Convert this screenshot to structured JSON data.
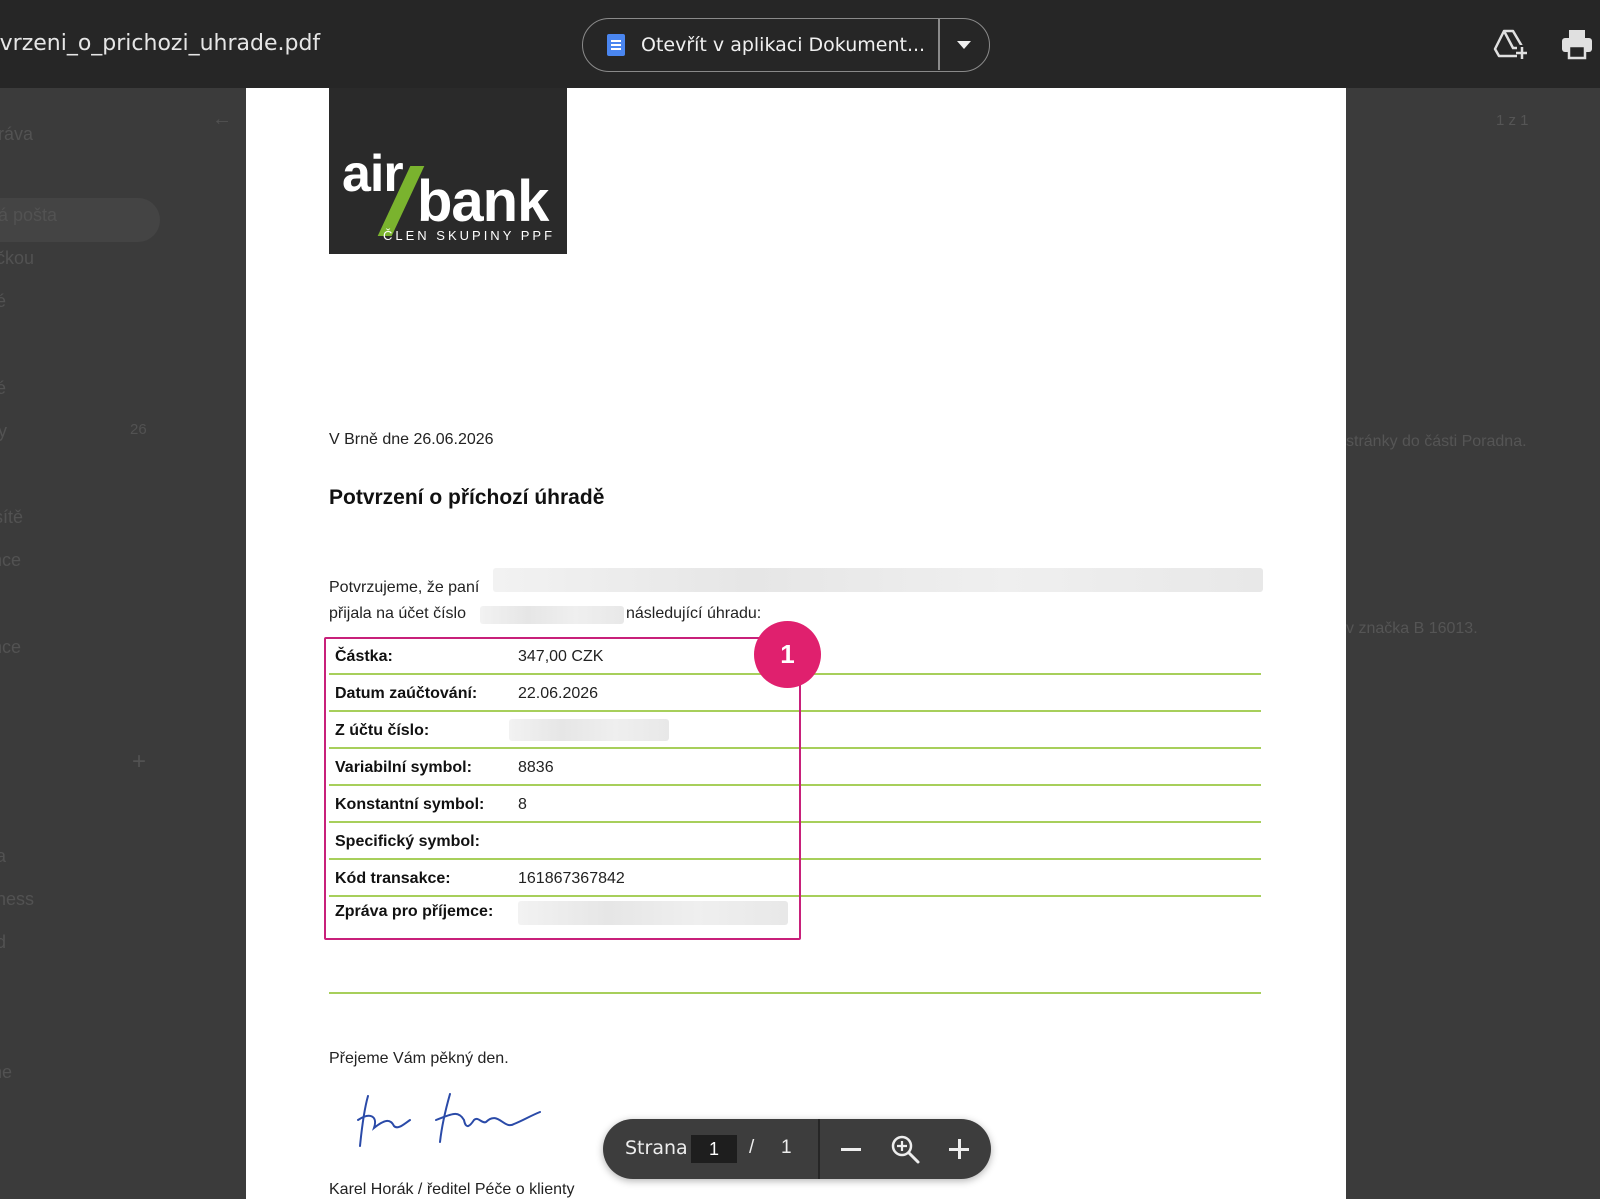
{
  "viewer": {
    "filename": "tvrzeni_o_prichozi_uhrade.pdf",
    "open_in_label": "Otevřít v aplikaci Dokument...",
    "icons": {
      "doc": "google-docs-icon",
      "dropdown": "chevron-down-icon",
      "drive": "add-to-drive-icon",
      "print": "print-icon"
    }
  },
  "background": {
    "left_items": [
      "ráva",
      "ná pošta",
      "čkou",
      "é",
      "é",
      "ry",
      "sítě",
      "nce",
      "nce",
      "a",
      "iness",
      "d",
      "ne"
    ],
    "left_count": "26",
    "right_texts": [
      "1 z 1",
      "stránky do části Poradna.",
      "v značka B 16013."
    ]
  },
  "document": {
    "logo": {
      "word1": "air",
      "word2": "bank",
      "subtitle": "ČLEN SKUPINY PPF",
      "brand_color": "#7ab32e"
    },
    "date_line": "V Brně dne  26.06.2026",
    "title": "Potvrzení o příchozí úhradě",
    "intro_line1": "Potvrzujeme, že paní",
    "intro_line2_a": "přijala na účet číslo",
    "intro_line2_b": "následující úhradu:",
    "rows": [
      {
        "label": "Částka:",
        "value": "347,00 CZK"
      },
      {
        "label": "Datum zaúčtování:",
        "value": "22.06.2026"
      },
      {
        "label": "Z účtu číslo:",
        "value": ""
      },
      {
        "label": "Variabilní symbol:",
        "value": "8836"
      },
      {
        "label": "Konstantní symbol:",
        "value": "8"
      },
      {
        "label": "Specifický symbol:",
        "value": ""
      },
      {
        "label": "Kód transakce:",
        "value": "161867367842"
      },
      {
        "label": "Zpráva pro příjemce:",
        "value": ""
      }
    ],
    "highlight_badge": "1",
    "highlight_color": "#e0206e",
    "closing": "Přejeme Vám pěkný den.",
    "signer": "Karel Horák / ředitel Péče o klienty"
  },
  "pager": {
    "label": "Strana",
    "current_page": "1",
    "separator": "/",
    "total_pages": "1",
    "icons": {
      "zoom_out": "minus-icon",
      "fit": "zoom-icon",
      "zoom_in": "plus-icon"
    }
  }
}
